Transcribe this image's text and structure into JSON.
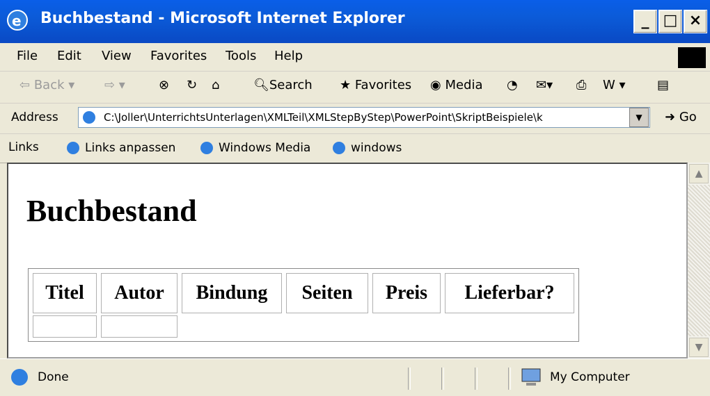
{
  "window": {
    "title": "Buchbestand - Microsoft Internet Explorer"
  },
  "menu": [
    "File",
    "Edit",
    "View",
    "Favorites",
    "Tools",
    "Help"
  ],
  "toolbar": {
    "back": "Back",
    "search": "Search",
    "favorites": "Favorites",
    "media": "Media"
  },
  "address": {
    "label": "Address",
    "value": "C:\\Joller\\UnterrichtsUnterlagen\\XMLTeil\\XMLStepByStep\\PowerPoint\\SkriptBeispiele\\k",
    "go": "Go"
  },
  "links": {
    "label": "Links",
    "items": [
      "Links anpassen",
      "Windows Media",
      "windows"
    ]
  },
  "page": {
    "heading": "Buchbestand",
    "columns": [
      "Titel",
      "Autor",
      "Bindung",
      "Seiten",
      "Preis",
      "Lieferbar?"
    ]
  },
  "status": {
    "text": "Done",
    "zone": "My Computer"
  }
}
